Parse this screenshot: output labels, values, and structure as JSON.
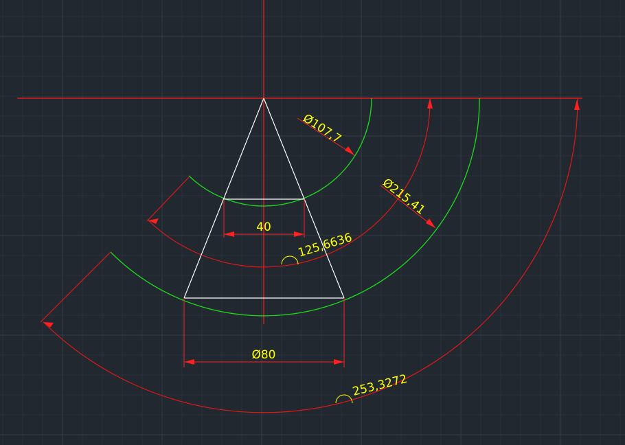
{
  "colors": {
    "background": "#212830",
    "grid_minor": "#29313b",
    "grid_major": "#343d48",
    "axis_line": "#ff1a1a",
    "profile_line": "#ffffff",
    "green_arc": "#1ed21e",
    "red_arc": "#e01818",
    "dimension_line": "#ff2020",
    "dimension_text": "#ffff00"
  },
  "dimensions": {
    "dia_small": "Ø107,7",
    "dia_large": "Ø215,41",
    "top_width": "40",
    "bottom_width": "Ø80",
    "arc_inner": "125,6636",
    "arc_outer": "253,3272"
  }
}
